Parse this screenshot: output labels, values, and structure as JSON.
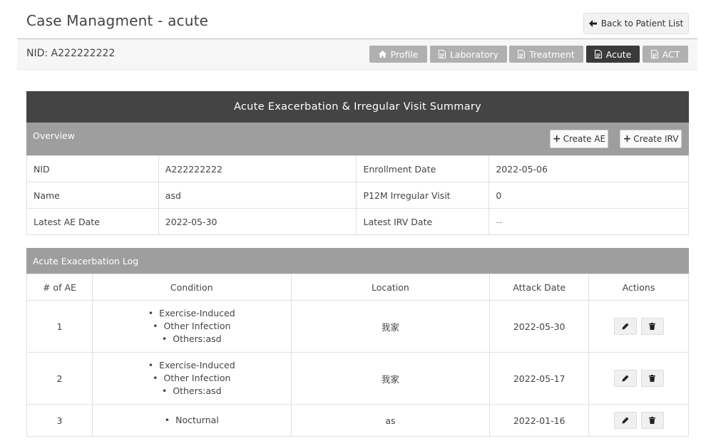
{
  "header": {
    "title": "Case Managment - acute",
    "back_label": "Back to Patient List"
  },
  "subbar": {
    "nid_label": "NID: A222222222",
    "tabs": [
      {
        "label": "Profile",
        "icon": "home-icon",
        "active": false
      },
      {
        "label": "Laboratory",
        "icon": "document-icon",
        "active": false
      },
      {
        "label": "Treatment",
        "icon": "document-icon",
        "active": false
      },
      {
        "label": "Acute",
        "icon": "document-icon",
        "active": true
      },
      {
        "label": "ACT",
        "icon": "document-icon",
        "active": false
      }
    ]
  },
  "summary": {
    "title": "Acute Exacerbation & Irregular Visit Summary",
    "overview_label": "Overview",
    "create_ae_label": "Create AE",
    "create_irv_label": "Create IRV",
    "rows": [
      {
        "k1": "NID",
        "v1": "A222222222",
        "k2": "Enrollment Date",
        "v2": "2022-05-06"
      },
      {
        "k1": "Name",
        "v1": "asd",
        "k2": "P12M Irregular Visit",
        "v2": "0"
      },
      {
        "k1": "Latest AE Date",
        "v1": "2022-05-30",
        "k2": "Latest IRV Date",
        "v2": "--"
      }
    ]
  },
  "log": {
    "title": "Acute Exacerbation Log",
    "columns": [
      "# of AE",
      "Condition",
      "Location",
      "Attack Date",
      "Actions"
    ],
    "rows": [
      {
        "num": "1",
        "conditions": [
          "Exercise-Induced",
          "Other Infection",
          "Others:asd"
        ],
        "location": "我家",
        "date": "2022-05-30"
      },
      {
        "num": "2",
        "conditions": [
          "Exercise-Induced",
          "Other Infection",
          "Others:asd"
        ],
        "location": "我家",
        "date": "2022-05-17"
      },
      {
        "num": "3",
        "conditions": [
          "Nocturnal"
        ],
        "location": "as",
        "date": "2022-01-16"
      }
    ]
  },
  "colors": {
    "dark_header": "#444444",
    "section_bar": "#9e9e9e",
    "tab_inactive": "#b0b0b0",
    "tab_active": "#3a3a3a"
  }
}
